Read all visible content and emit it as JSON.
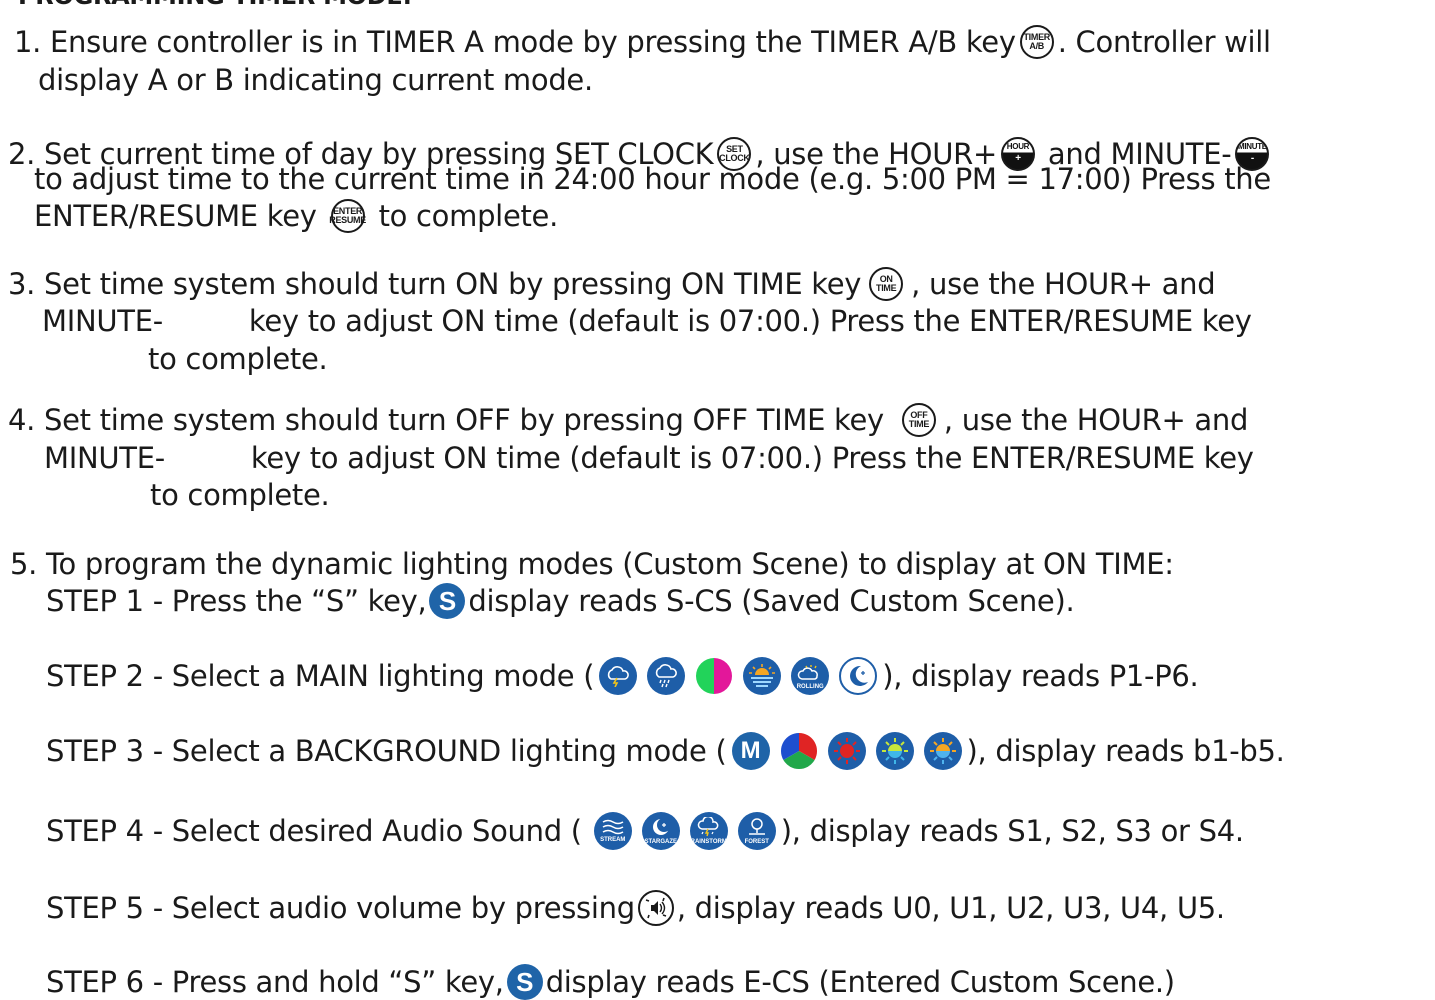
{
  "heading": "PROGRAMMING TIMER MODE:",
  "steps": {
    "s1": {
      "a": "1. Ensure controller is in TIMER A mode by pressing the TIMER A/B key",
      "b": ". Controller will",
      "c": "display A or B indicating current mode."
    },
    "s2": {
      "a": "2. Set current time of day by pressing SET CLOCK",
      "b": ", use the HOUR+",
      "c": " and MINUTE-",
      "d": "to adjust time to the current time in 24:00 hour mode (e.g. 5:00 PM = 17:00) Press the",
      "e": "ENTER/RESUME key",
      "f": "to complete."
    },
    "s3": {
      "a": "3. Set time system should turn ON by pressing ON TIME key",
      "b": ", use the HOUR+ and",
      "c": "MINUTE-",
      "d": "key to adjust ON time (default is 07:00.) Press the ENTER/RESUME key",
      "e": "to complete."
    },
    "s4": {
      "a": "4. Set time system should turn OFF by pressing OFF TIME key",
      "b": ", use the HOUR+ and",
      "c": "MINUTE-",
      "d": "key to adjust ON time (default is 07:00.) Press the ENTER/RESUME key",
      "e": "to complete."
    },
    "s5": {
      "intro": "5. To program the dynamic lighting modes (Custom Scene) to display at ON TIME:",
      "step1a": "STEP 1 - Press the “S” key,",
      "step1b": "display reads S-CS (Saved Custom Scene).",
      "step2a": "STEP 2 - Select a MAIN lighting mode (",
      "step2b": "), display reads P1-P6.",
      "step3a": "STEP 3 - Select a BACKGROUND lighting mode (",
      "step3b": "), display reads b1-b5.",
      "step4a": "STEP 4 - Select desired Audio Sound (",
      "step4b": "), display reads S1, S2, S3 or S4.",
      "step5a": "STEP 5 - Select audio volume by pressing",
      "step5b": ", display reads U0, U1, U2, U3, U4, U5.",
      "step6a": "STEP 6 - Press and hold “S” key,",
      "step6b": "display reads E-CS (Entered Custom Scene.)"
    }
  },
  "keys": {
    "timer_top": "TIMER",
    "timer_bot": "A/B",
    "set_top": "SET",
    "set_bot": "CLOCK",
    "hour_top": "HOUR",
    "hour_bot": "+",
    "minute_top": "MINUTE",
    "minute_bot": "-",
    "enter_top": "ENTER",
    "enter_bot": "RESUME",
    "on_top": "ON",
    "on_bot": "TIME",
    "off_top": "OFF",
    "off_bot": "TIME",
    "s_key": "S",
    "rolling": "ROLLING",
    "m_key": "M",
    "stream": "STREAM",
    "stargaze": "STARGAZE",
    "rainstorm": "RAINSTORM",
    "forest": "FOREST"
  },
  "icons": {
    "main_modes": [
      "storm-cloud-icon",
      "rain-cloud-icon",
      "color-wheel-icon",
      "sunset-icon",
      "rolling-clouds-icon",
      "moon-icon"
    ],
    "background_modes": [
      "m-icon",
      "rgb-wheel-icon",
      "red-sun-icon",
      "green-sun-icon",
      "blue-sun-icon"
    ],
    "audio_sounds": [
      "stream-icon",
      "stargaze-icon",
      "rainstorm-icon",
      "forest-icon"
    ],
    "volume": "volume-icon"
  },
  "colors": {
    "text": "#1a1a1a",
    "button_blue": "#1e5ea8"
  }
}
